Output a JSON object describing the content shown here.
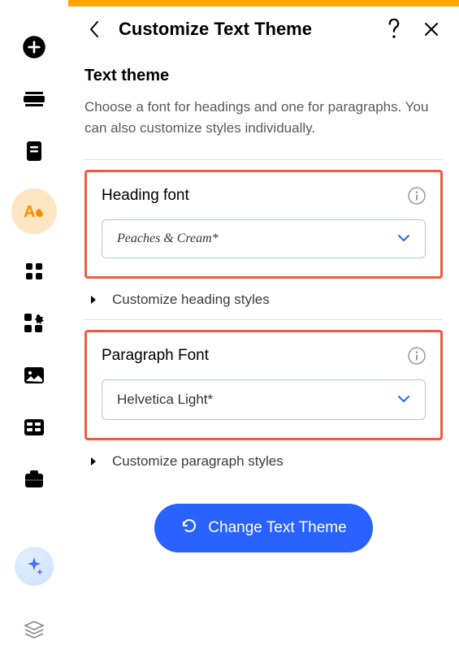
{
  "header": {
    "title": "Customize Text Theme"
  },
  "theme": {
    "section_title": "Text theme",
    "description": "Choose a font for headings and one for paragraphs. You can also customize styles individually."
  },
  "heading": {
    "label": "Heading font",
    "value": "Peaches & Cream*",
    "expand_label": "Customize heading styles"
  },
  "paragraph": {
    "label": "Paragraph Font",
    "value": "Helvetica Light*",
    "expand_label": "Customize paragraph styles"
  },
  "change_button": "Change Text Theme"
}
